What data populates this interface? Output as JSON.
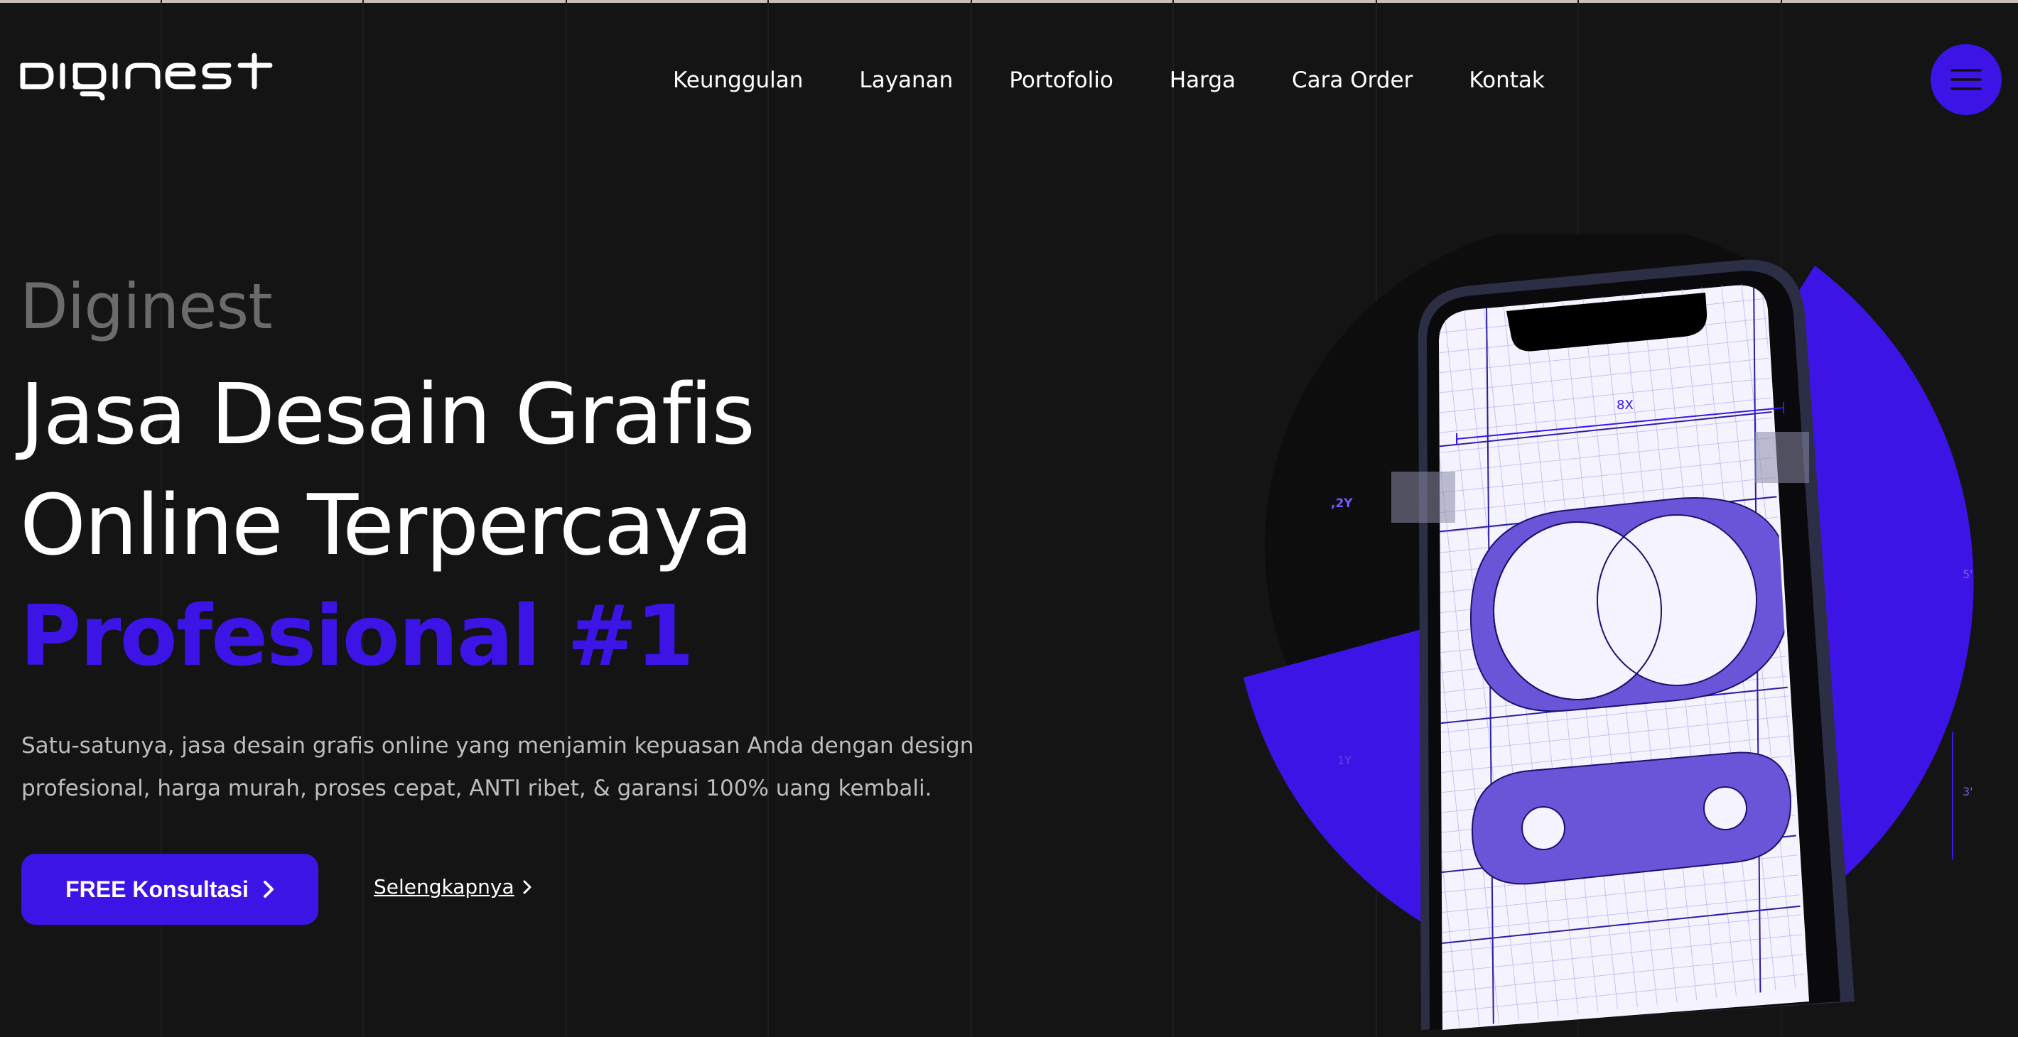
{
  "brand": {
    "name": "diginest"
  },
  "nav": {
    "items": [
      {
        "label": "Keunggulan"
      },
      {
        "label": "Layanan"
      },
      {
        "label": "Portofolio"
      },
      {
        "label": "Harga"
      },
      {
        "label": "Cara Order"
      },
      {
        "label": "Kontak"
      }
    ]
  },
  "hero": {
    "eyebrow": "Diginest",
    "headline_line1": "Jasa Desain Grafis",
    "headline_line2": "Online Terpercaya",
    "headline_accent": "Profesional #1",
    "description": "Satu-satunya, jasa desain grafis online yang menjamin kepuasan Anda dengan design profesional, harga murah, proses cepat, ANTI ribet, & garansi 100% uang kembali.",
    "cta_label": "FREE Konsultasi",
    "more_label": "Selengkapnya"
  },
  "illustration": {
    "labels": {
      "width": "8X",
      "offset": ",2Y",
      "spacing": "1Y",
      "right_top": "5'",
      "right_bottom": "3'"
    }
  },
  "colors": {
    "accent": "#3d14e6",
    "background": "#141414",
    "muted_text": "#bdbdbd"
  },
  "icons": {
    "menu": "hamburger-icon",
    "cta_arrow": "chevron-right-icon",
    "more_arrow": "chevron-right-icon"
  }
}
